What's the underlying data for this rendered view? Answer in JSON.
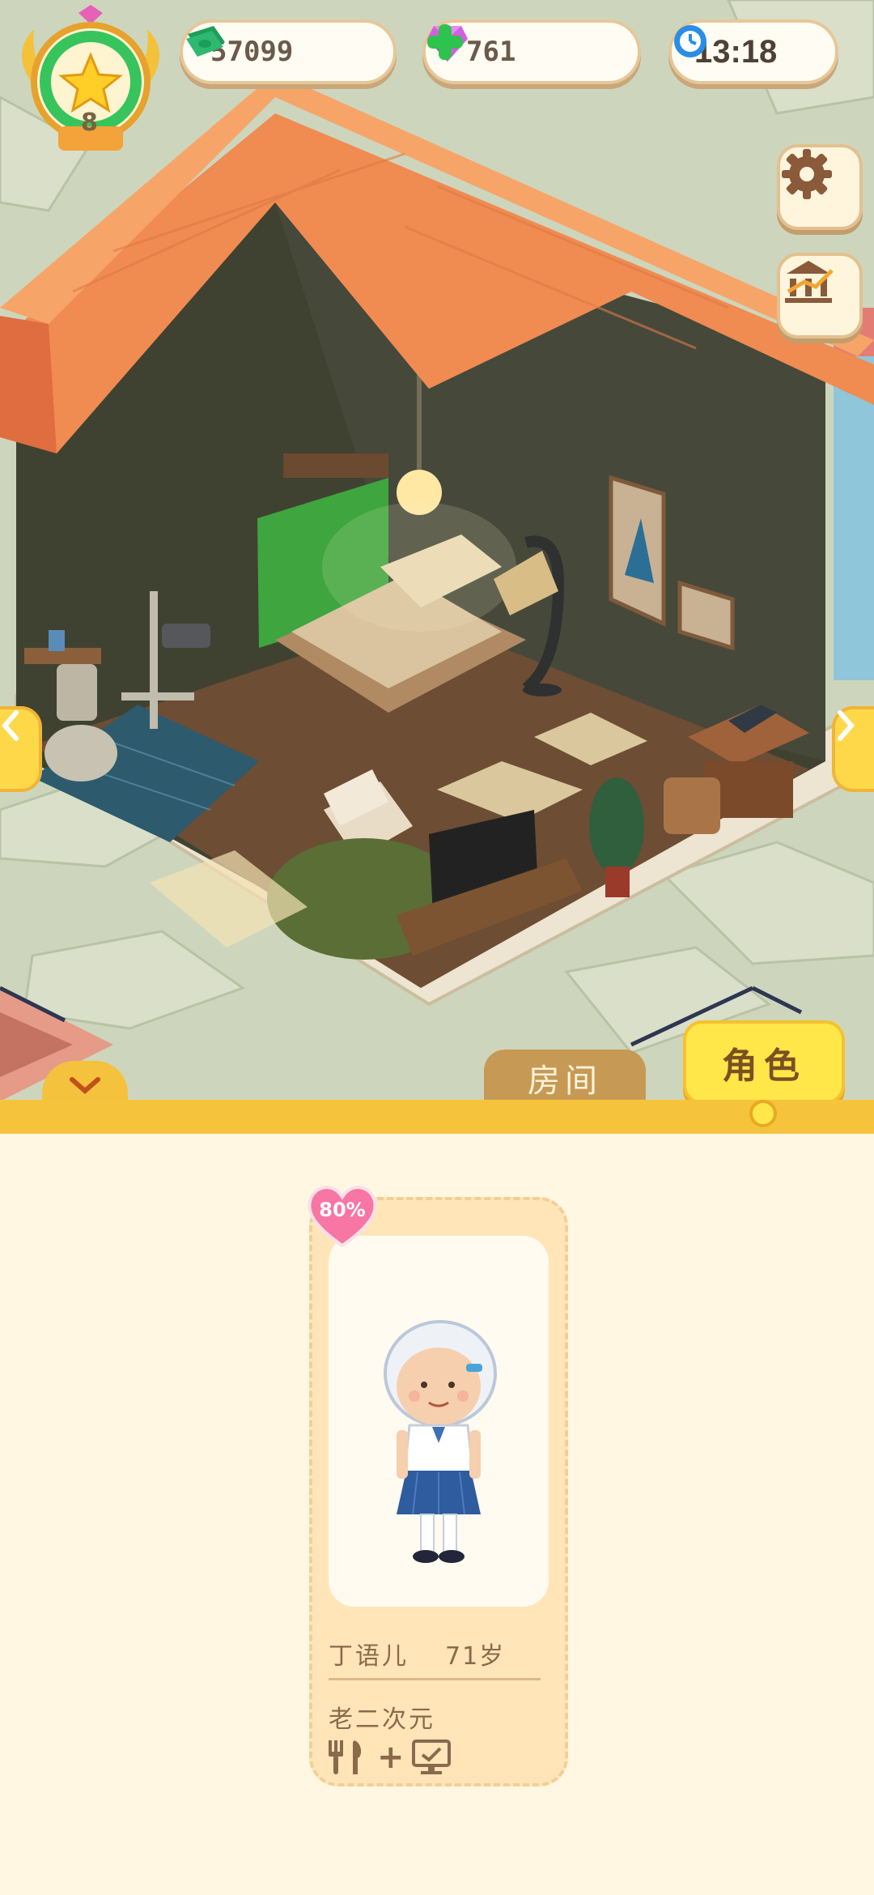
{
  "hud": {
    "level": "8",
    "cash": "57099",
    "gems": "761",
    "clock": "13:18"
  },
  "tabs": {
    "room_label": "房间",
    "role_label": "角色"
  },
  "character": {
    "affection": "80%",
    "name": "丁语儿",
    "age": "71岁",
    "trait": "老二次元",
    "needs": [
      "utensils-icon",
      "plus",
      "monitor-icon"
    ]
  },
  "colors": {
    "accent_yellow": "#ffe74a",
    "panel_band": "#f6c43c",
    "cash_green": "#2eb872",
    "gem_pink": "#d35fe0",
    "clock_blue": "#2a8de6"
  }
}
